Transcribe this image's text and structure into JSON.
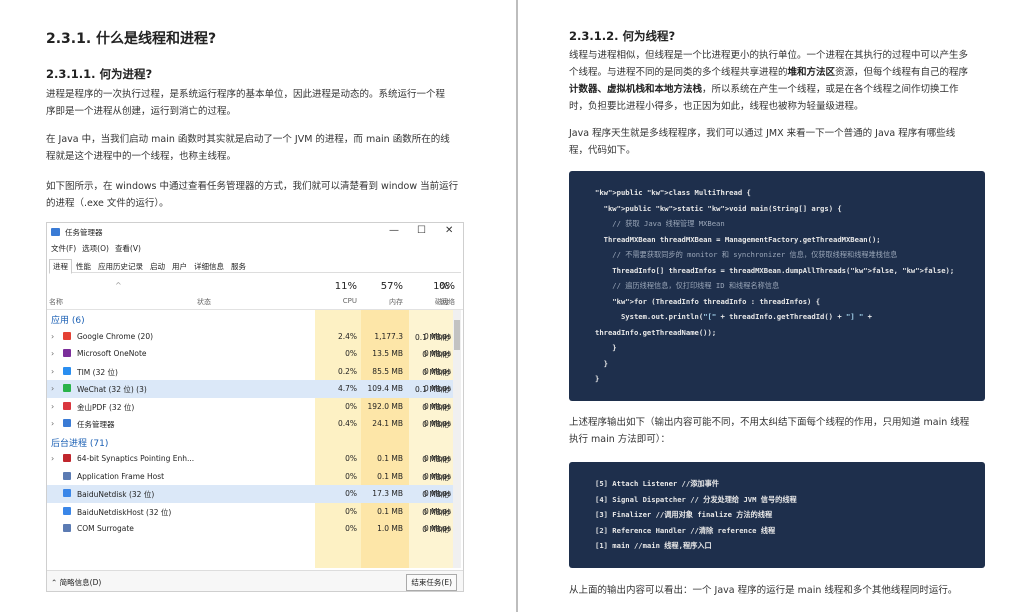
{
  "left": {
    "h1": "2.3.1. 什么是线程和进程?",
    "h2": "2.3.1.1. 何为进程?",
    "p1": [
      "进程是程序的一次执行过程，是系统运行程序的基本单位，因此进程是动态的。系统运行一个程",
      "序即是一个进程从创建，运行到消亡的过程。"
    ],
    "p2": [
      "在 Java 中，当我们启动 main 函数时其实就是启动了一个 JVM 的进程，而 main 函数所在的线",
      "程就是这个进程中的一个线程，也称主线程。"
    ],
    "p3": [
      "如下图所示，在 windows 中通过查看任务管理器的方式，我们就可以清楚看到 window 当前运行",
      "的进程（.exe 文件的运行）。"
    ],
    "taskmgr": {
      "title": "任务管理器",
      "win_controls": [
        "—",
        "☐",
        "✕"
      ],
      "menu": [
        "文件(F)",
        "选项(O)",
        "查看(V)"
      ],
      "tabs": [
        "进程",
        "性能",
        "应用历史记录",
        "启动",
        "用户",
        "详细信息",
        "服务"
      ],
      "headers": {
        "name": "名称",
        "status": "状态",
        "cpu_pct": "11%",
        "cpu": "CPU",
        "mem_pct": "57%",
        "mem": "内存",
        "disk_pct": "1%",
        "disk": "磁盘",
        "net_pct": "0%",
        "net": "网络"
      },
      "rows": [
        {
          "type": "group",
          "name": "应用 (6)"
        },
        {
          "type": "proc",
          "exp": "›",
          "name": "Google Chrome (20)",
          "cpu": "2.4%",
          "mem": "1,177.3",
          "disk": "0.1 MB/秒",
          "net": "0 Mbps",
          "icon": "#e44134"
        },
        {
          "type": "proc",
          "exp": "›",
          "name": "Microsoft OneNote",
          "cpu": "0%",
          "mem": "13.5 MB",
          "disk": "0 MB/秒",
          "net": "0 Mbps",
          "icon": "#7b2e9a"
        },
        {
          "type": "proc",
          "exp": "›",
          "name": "TIM (32 位)",
          "cpu": "0.2%",
          "mem": "85.5 MB",
          "disk": "0 MB/秒",
          "net": "0 Mbps",
          "icon": "#2a8ef0"
        },
        {
          "type": "proc",
          "exp": "›",
          "name": "WeChat (32 位) (3)",
          "cpu": "4.7%",
          "mem": "109.4 MB",
          "disk": "0.1 MB/秒",
          "net": "0 Mbps",
          "icon": "#2ab34a",
          "highlight": true
        },
        {
          "type": "proc",
          "exp": "›",
          "name": "金山PDF (32 位)",
          "cpu": "0%",
          "mem": "192.0 MB",
          "disk": "0 MB/秒",
          "net": "0 Mbps",
          "icon": "#d9363e"
        },
        {
          "type": "proc",
          "exp": "›",
          "name": "任务管理器",
          "cpu": "0.4%",
          "mem": "24.1 MB",
          "disk": "0 MB/秒",
          "net": "0 Mbps",
          "icon": "#3a7bd5"
        },
        {
          "type": "group",
          "name": "后台进程 (71)"
        },
        {
          "type": "proc",
          "exp": "›",
          "name": "64-bit Synaptics Pointing Enh...",
          "cpu": "0%",
          "mem": "0.1 MB",
          "disk": "0 MB/秒",
          "net": "0 Mbps",
          "icon": "#c0262d"
        },
        {
          "type": "proc",
          "exp": "",
          "name": "Application Frame Host",
          "cpu": "0%",
          "mem": "0.1 MB",
          "disk": "0 MB/秒",
          "net": "0 Mbps",
          "icon": "#5b7bb3"
        },
        {
          "type": "proc",
          "exp": "",
          "name": "BaiduNetdisk (32 位)",
          "cpu": "0%",
          "mem": "17.3 MB",
          "disk": "0 MB/秒",
          "net": "0 Mbps",
          "icon": "#3a86e8",
          "highlight": true
        },
        {
          "type": "proc",
          "exp": "",
          "name": "BaiduNetdiskHost (32 位)",
          "cpu": "0%",
          "mem": "0.1 MB",
          "disk": "0 MB/秒",
          "net": "0 Mbps",
          "icon": "#3a86e8"
        },
        {
          "type": "proc",
          "exp": "",
          "name": "COM Surrogate",
          "cpu": "0%",
          "mem": "1.0 MB",
          "disk": "0 MB/秒",
          "net": "0 Mbps",
          "icon": "#5b7bb3"
        }
      ],
      "footer_less": "简略信息(D)",
      "footer_end": "结束任务(E)"
    }
  },
  "right": {
    "h3": "2.3.1.2. 何为线程?",
    "p1": [
      "线程与进程相似，但线程是一个比进程更小的执行单位。一个进程在其执行的过程中可以产生多",
      "个线程。与进程不同的是同类的多个线程共享进程的堆和方法区资源，但每个线程有自己的程序",
      "计数器、虚拟机栈和本地方法栈，所以系统在产生一个线程，或是在各个线程之间作切换工作",
      "时，负担要比进程小得多，也正因为如此，线程也被称为轻量级进程。"
    ],
    "p1_bold": [
      "",
      "堆和方法区",
      "计数器、虚拟机栈和本地方法栈",
      ""
    ],
    "p2": [
      "Java 程序天生就是多线程程序，我们可以通过 JMX 来看一下一个普通的 Java 程序有哪些线",
      "程，代码如下。"
    ],
    "code1": [
      "public class MultiThread {",
      "  public static void main(String[] args) {",
      "    // 获取 Java 线程管理 MXBean",
      "  ThreadMXBean threadMXBean = ManagementFactory.getThreadMXBean();",
      "    // 不需要获取同步的 monitor 和 synchronizer 信息，仅获取线程和线程堆栈信息",
      "    ThreadInfo[] threadInfos = threadMXBean.dumpAllThreads(false, false);",
      "    // 遍历线程信息，仅打印线程 ID 和线程名称信息",
      "    for (ThreadInfo threadInfo : threadInfos) {",
      "      System.out.println(\"[\" + threadInfo.getThreadId() + \"] \" +",
      "threadInfo.getThreadName());",
      "    }",
      "  }",
      "}"
    ],
    "p3": [
      "上述程序输出如下（输出内容可能不同，不用太纠结下面每个线程的作用，只用知道 main 线程",
      "执行 main 方法即可）："
    ],
    "code2": [
      "[5] Attach Listener //添加事件",
      "[4] Signal Dispatcher // 分发处理给 JVM 信号的线程",
      "[3] Finalizer //调用对象 finalize 方法的线程",
      "[2] Reference Handler //清除 reference 线程",
      "[1] main //main 线程,程序入口"
    ],
    "p4": "从上面的输出内容可以看出：一个 Java 程序的运行是 main 线程和多个其他线程同时运行。"
  }
}
